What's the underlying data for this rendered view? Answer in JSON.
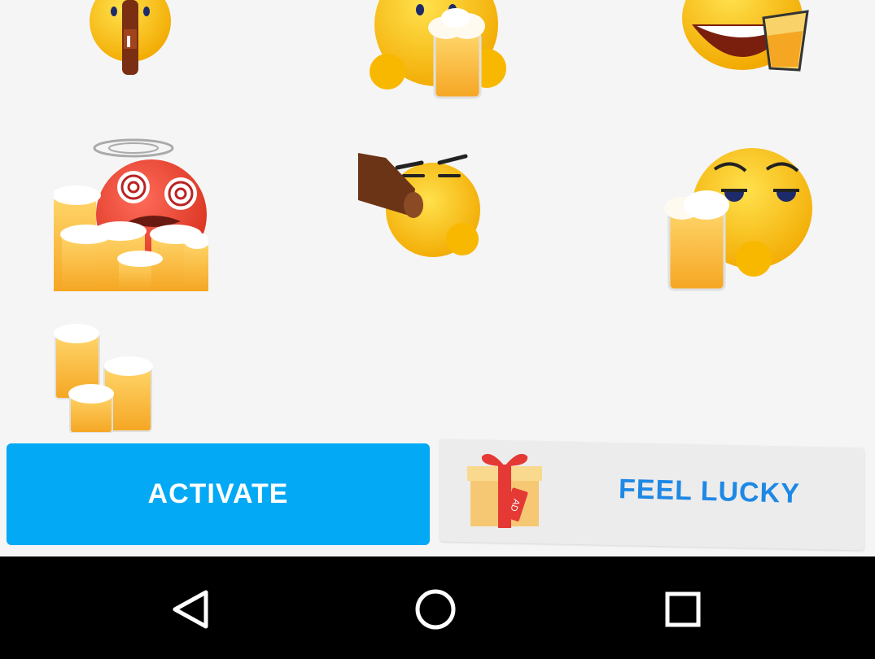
{
  "stickers": [
    {
      "name": "beer-bottle-emoji"
    },
    {
      "name": "foam-mouth-beer-emoji"
    },
    {
      "name": "laughing-beer-emoji"
    },
    {
      "name": "dizzy-beers-emoji"
    },
    {
      "name": "chugging-bottle-emoji"
    },
    {
      "name": "relaxed-beer-emoji"
    },
    {
      "name": "beer-mugs-pile"
    }
  ],
  "actions": {
    "activate_label": "ACTIVATE",
    "lucky_label": "FEEL LUCKY",
    "gift_tag": "AD"
  },
  "navbar": {
    "back_icon": "back-triangle-icon",
    "home_icon": "home-circle-icon",
    "recents_icon": "recents-square-icon"
  },
  "colors": {
    "accent": "#03a9f4",
    "lucky_text": "#1e88e5",
    "emoji_yellow": "#fbc02d",
    "beer": "#f9b233",
    "navbar": "#000000"
  }
}
